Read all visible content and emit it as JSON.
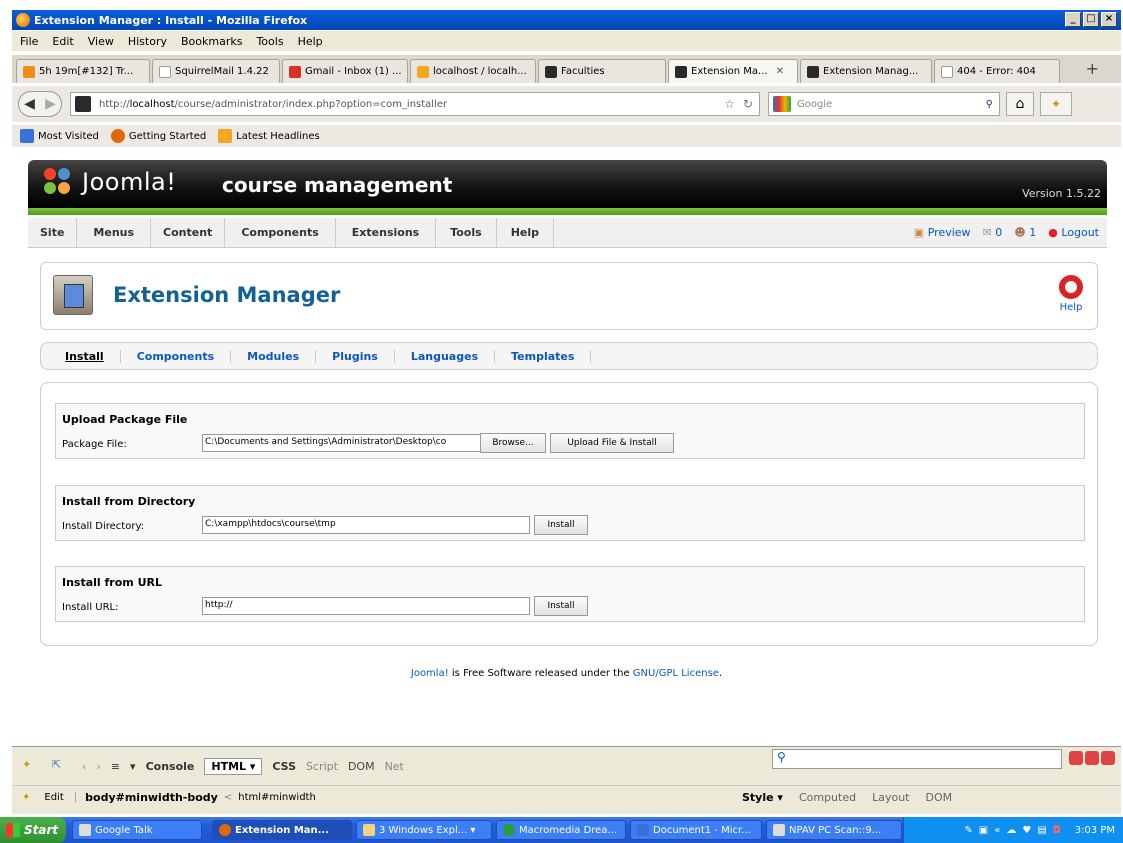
{
  "window": {
    "title": "Extension Manager : Install - Mozilla Firefox"
  },
  "menubar": [
    "File",
    "Edit",
    "View",
    "History",
    "Bookmarks",
    "Tools",
    "Help"
  ],
  "tabs": [
    {
      "label": "5h 19m[#132] Tr...",
      "color": "#f08c1a"
    },
    {
      "label": "SquirrelMail 1.4.22",
      "color": "#dddddd"
    },
    {
      "label": "Gmail - Inbox (1) ...",
      "color": "#d93025"
    },
    {
      "label": "localhost / localh...",
      "color": "#f5a623"
    },
    {
      "label": "Faculties",
      "color": "#2a2a2a"
    },
    {
      "label": "Extension Ma...",
      "color": "#2a2a2a",
      "active": true
    },
    {
      "label": "Extension Manag...",
      "color": "#2a2a2a"
    },
    {
      "label": "404 - Error: 404",
      "color": "#dddddd"
    }
  ],
  "nav": {
    "url_prefix": "http://",
    "url_host": "localhost",
    "url_rest": "/course/administrator/index.php?option=com_installer",
    "search_placeholder": "Google"
  },
  "bookmarks": [
    "Most Visited",
    "Getting Started",
    "Latest Headlines"
  ],
  "joomla": {
    "logo": "Joomla!",
    "sitename": "course management",
    "version": "Version 1.5.22",
    "menu": [
      "Site",
      "Menus",
      "Content",
      "Components",
      "Extensions",
      "Tools",
      "Help"
    ],
    "status": {
      "preview": "Preview",
      "messages": "0",
      "users": "1",
      "logout": "Logout"
    }
  },
  "page": {
    "title": "Extension Manager",
    "help": "Help",
    "subnav": [
      "Install",
      "Components",
      "Modules",
      "Plugins",
      "Languages",
      "Templates"
    ],
    "sections": {
      "upload": {
        "legend": "Upload Package File",
        "label": "Package File:",
        "value": "C:\\Documents and Settings\\Administrator\\Desktop\\co",
        "browse": "Browse...",
        "submit": "Upload File & Install"
      },
      "directory": {
        "legend": "Install from Directory",
        "label": "Install Directory:",
        "value": "C:\\xampp\\htdocs\\course\\tmp",
        "submit": "Install"
      },
      "url": {
        "legend": "Install from URL",
        "label": "Install URL:",
        "value": "http://",
        "submit": "Install"
      }
    },
    "footer": {
      "joomla": "Joomla!",
      "mid": " is Free Software released under the ",
      "license": "GNU/GPL License",
      "end": "."
    }
  },
  "firebug": {
    "tabs": [
      "Console",
      "HTML ▾",
      "CSS",
      "Script",
      "DOM",
      "Net"
    ],
    "edit": "Edit",
    "crumb1": "body#minwidth-body",
    "crumb_sep": "<",
    "crumb2": "html#minwidth",
    "right_tabs": [
      "Style ▾",
      "Computed",
      "Layout",
      "DOM"
    ]
  },
  "taskbar": {
    "start": "Start",
    "tasks": [
      "Google Talk",
      "Extension Man...",
      "3 Windows Expl... ▾",
      "Macromedia Drea...",
      "Document1 - Micr...",
      "NPAV PC Scan::9..."
    ],
    "clock": "3:03 PM"
  }
}
